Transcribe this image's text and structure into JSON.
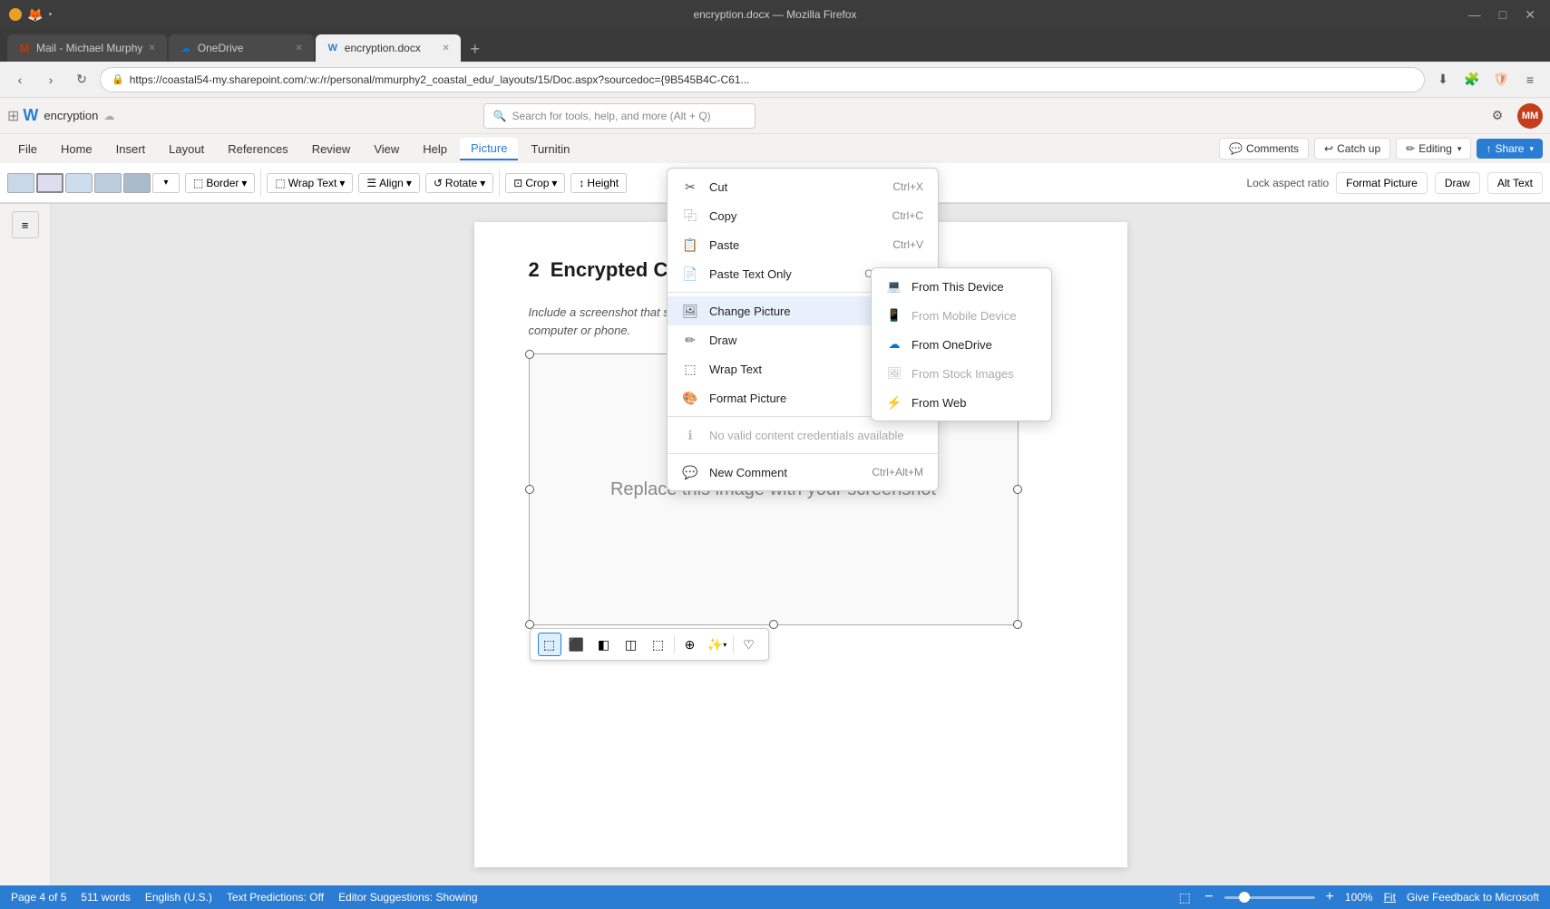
{
  "browser": {
    "title": "encryption.docx — Mozilla Firefox",
    "tabs": [
      {
        "label": "Mail - Michael Murphy",
        "icon": "M",
        "icon_color": "#cc3300",
        "active": false
      },
      {
        "label": "OneDrive",
        "icon": "☁",
        "icon_color": "#0078d4",
        "active": false
      },
      {
        "label": "encryption.docx",
        "icon": "W",
        "icon_color": "#2b7cd3",
        "active": true
      }
    ],
    "url": "https://coastal54-my.sharepoint.com/:w:/r/personal/mmurphy2_coastal_edu/_layouts/15/Doc.aspx?sourcedoc={9B545B4C-C61...",
    "back_btn": "‹",
    "forward_btn": "›",
    "refresh_btn": "↻"
  },
  "word": {
    "doc_name": "encryption",
    "search_placeholder": "Search for tools, help, and more (Alt + Q)",
    "logo": "W",
    "nav_tabs": [
      "File",
      "Home",
      "Insert",
      "Layout",
      "References",
      "Review",
      "View",
      "Help",
      "Picture",
      "Turnitin"
    ],
    "active_tab": "Picture",
    "ribbon_buttons": {
      "border_label": "Border",
      "wrap_text_label": "Wrap Text",
      "align_label": "Align",
      "rotate_label": "Rotate",
      "crop_label": "Crop",
      "height_label": "Height"
    },
    "right_buttons": {
      "comments": "Comments",
      "catchup": "Catch up",
      "editing": "Editing",
      "share": "Share"
    },
    "format_picture": "Format Picture",
    "draw": "Draw",
    "alt_text": "Alt Text",
    "lock_aspect": "Lock aspect ratio"
  },
  "document": {
    "heading_number": "2",
    "heading_text": "Encrypted Communication",
    "body_text": "Include a screenshot that shows that you have installed and are using an encryption app on your computer or phone.",
    "image_placeholder": "Replace this image with your screenshot"
  },
  "context_menu": {
    "items": [
      {
        "label": "Cut",
        "shortcut": "Ctrl+X",
        "icon": "✂",
        "disabled": false,
        "has_submenu": false
      },
      {
        "label": "Copy",
        "shortcut": "Ctrl+C",
        "icon": "⿻",
        "disabled": false,
        "has_submenu": false
      },
      {
        "label": "Paste",
        "shortcut": "Ctrl+V",
        "icon": "📋",
        "disabled": false,
        "has_submenu": false
      },
      {
        "label": "Paste Text Only",
        "shortcut": "Ctrl+Shift+V",
        "icon": "📄",
        "disabled": false,
        "has_submenu": false
      },
      {
        "separator": true
      },
      {
        "label": "Change Picture",
        "shortcut": "",
        "icon": "🖼",
        "disabled": false,
        "has_submenu": true,
        "highlighted": true
      },
      {
        "label": "Draw",
        "shortcut": "",
        "icon": "✏",
        "disabled": false,
        "has_submenu": false
      },
      {
        "label": "Wrap Text",
        "shortcut": "",
        "icon": "⬚",
        "disabled": false,
        "has_submenu": true
      },
      {
        "label": "Format Picture",
        "shortcut": "",
        "icon": "🎨",
        "disabled": false,
        "has_submenu": false
      },
      {
        "separator": true
      },
      {
        "label": "No valid content credentials available",
        "icon": "ℹ",
        "disabled": true,
        "has_submenu": false
      },
      {
        "separator": true
      },
      {
        "label": "New Comment",
        "shortcut": "Ctrl+Alt+M",
        "icon": "💬",
        "disabled": false,
        "has_submenu": false
      }
    ]
  },
  "submenu": {
    "items": [
      {
        "label": "From This Device",
        "icon": "💻",
        "disabled": false
      },
      {
        "label": "From Mobile Device",
        "icon": "📱",
        "disabled": true
      },
      {
        "label": "From OneDrive",
        "icon": "☁",
        "disabled": false
      },
      {
        "label": "From Stock Images",
        "icon": "🖼",
        "disabled": true
      },
      {
        "label": "From Web",
        "icon": "⚡",
        "disabled": false
      }
    ]
  },
  "statusbar": {
    "page_info": "Page 4 of 5",
    "word_count": "511 words",
    "language": "English (U.S.)",
    "text_predictions": "Text Predictions: Off",
    "editor_suggestions": "Editor Suggestions: Showing",
    "zoom_percent": "100%",
    "fit_label": "Fit",
    "feedback_label": "Give Feedback to Microsoft"
  }
}
